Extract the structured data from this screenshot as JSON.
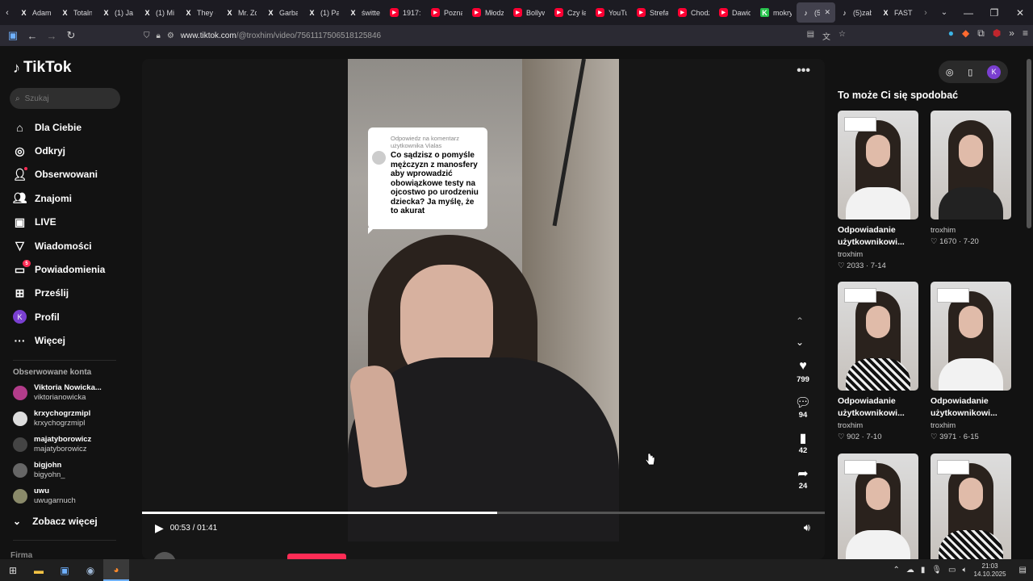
{
  "browser": {
    "tabs": [
      {
        "label": "Adam",
        "icon": "x-icon"
      },
      {
        "label": "Totaln",
        "icon": "x-icon"
      },
      {
        "label": "(1) Jac",
        "icon": "x-icon"
      },
      {
        "label": "(1) Mi",
        "icon": "x-icon"
      },
      {
        "label": "They c",
        "icon": "x-icon"
      },
      {
        "label": "Mr. Zo",
        "icon": "x-icon"
      },
      {
        "label": "Garba",
        "icon": "x-icon"
      },
      {
        "label": "(1) Pa",
        "icon": "x-icon"
      },
      {
        "label": "świtte",
        "icon": "x-icon"
      },
      {
        "label": "1917:",
        "icon": "youtube-icon"
      },
      {
        "label": "Pozna",
        "icon": "youtube-icon"
      },
      {
        "label": "Młodz",
        "icon": "youtube-icon"
      },
      {
        "label": "Bollyw",
        "icon": "youtube-icon"
      },
      {
        "label": "Czy ła",
        "icon": "youtube-icon"
      },
      {
        "label": "YouTu",
        "icon": "youtube-icon"
      },
      {
        "label": "Strefa",
        "icon": "youtube-icon"
      },
      {
        "label": "Chodz",
        "icon": "youtube-icon"
      },
      {
        "label": "Dawid",
        "icon": "youtube-icon"
      },
      {
        "label": "mokry",
        "icon": "k-icon"
      },
      {
        "label": "(5)",
        "icon": "tiktok-icon",
        "active": true
      },
      {
        "label": "(5)zab",
        "icon": "tiktok-icon"
      },
      {
        "label": "FAST l",
        "icon": "x-icon"
      }
    ],
    "url_domain": "www.tiktok.com",
    "url_path": "/@troxhim/video/7561117506518125846"
  },
  "sidebar": {
    "logo": "TikTok",
    "search_placeholder": "Szukaj",
    "nav": [
      {
        "label": "Dla Ciebie",
        "icon": "home-icon"
      },
      {
        "label": "Odkryj",
        "icon": "compass-icon"
      },
      {
        "label": "Obserwowani",
        "icon": "following-icon"
      },
      {
        "label": "Znajomi",
        "icon": "friends-icon"
      },
      {
        "label": "LIVE",
        "icon": "live-icon"
      },
      {
        "label": "Wiadomości",
        "icon": "send-icon"
      },
      {
        "label": "Powiadomienia",
        "icon": "inbox-icon",
        "badge": "5"
      },
      {
        "label": "Prześlij",
        "icon": "upload-icon"
      },
      {
        "label": "Profil",
        "icon": "avatar",
        "avatar_letter": "K"
      },
      {
        "label": "Więcej",
        "icon": "more-icon"
      }
    ],
    "followed_header": "Obserwowane konta",
    "accounts": [
      {
        "name": "Viktoria Nowicka...",
        "handle": "viktorianowicka"
      },
      {
        "name": "krxychogrzmipl",
        "handle": "krxychogrzmipl"
      },
      {
        "name": "majatyborowicz",
        "handle": "majatyborowicz"
      },
      {
        "name": "bigjohn",
        "handle": "bigyohn_"
      },
      {
        "name": "uwu",
        "handle": "uwugarnuch"
      }
    ],
    "see_more": "Zobacz więcej",
    "company": "Firma"
  },
  "video": {
    "bubble_header": "Odpowiedz na komentarz użytkownika Vialas",
    "bubble_text": "Co sądzisz o pomyśle mężczyzn z manosfery aby wprowadzić obowiązkowe testy na ojcostwo po urodzeniu dziecka? Ja myślę, że to akurat",
    "likes": "799",
    "comments": "94",
    "saves": "42",
    "shares": "24",
    "time": "00:53 / 01:41",
    "progress": 0.52,
    "author": "troxhim"
  },
  "recommendations": {
    "title": "To może Ci się spodobać",
    "avatar_letter": "K",
    "cards": [
      {
        "title": "Odpowiadanie użytkownikowi...",
        "user": "troxhim",
        "likes": "2033",
        "date": "7-14",
        "outfit": "light"
      },
      {
        "title": "",
        "user": "troxhim",
        "likes": "1670",
        "date": "7-20",
        "outfit": "dark"
      },
      {
        "title": "Odpowiadanie użytkownikowi...",
        "user": "troxhim",
        "likes": "902",
        "date": "7-10",
        "outfit": "floral"
      },
      {
        "title": "Odpowiadanie użytkownikowi...",
        "user": "troxhim",
        "likes": "3971",
        "date": "6-15",
        "outfit": "light"
      },
      {
        "title": "",
        "user": "",
        "likes": "",
        "date": "",
        "outfit": "light"
      },
      {
        "title": "",
        "user": "",
        "likes": "",
        "date": "",
        "outfit": "floral"
      }
    ]
  },
  "taskbar": {
    "time": "21:03",
    "date": "14.10.2025"
  }
}
